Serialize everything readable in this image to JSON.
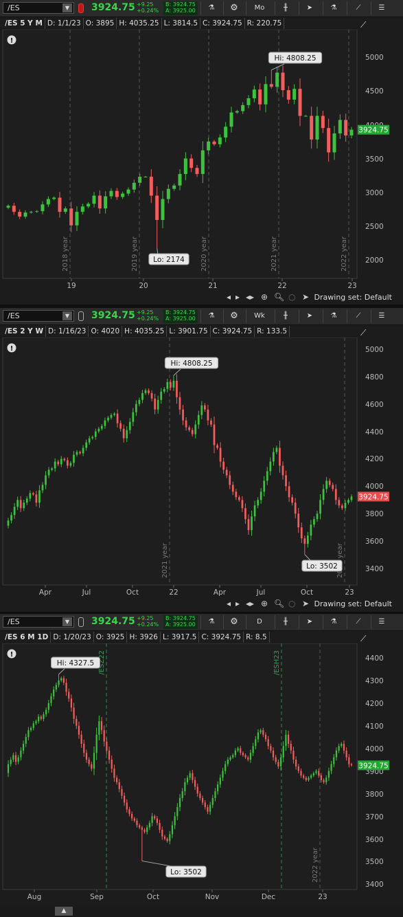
{
  "quote": {
    "price": "3924.75",
    "change": "+9.25",
    "change_pct": "+0.24%",
    "bid": "B: 3924.75",
    "ask": "A: 3925.00"
  },
  "footer": {
    "drawing_set": "Drawing set: Default"
  },
  "colors": {
    "up": "#3cc23c",
    "down": "#f25d5d",
    "price_label": "#1faa2f",
    "price_label_down": "#e84c4c"
  },
  "panels": [
    {
      "symbol": "/ES",
      "aggregation": "Mo",
      "link_color": "red",
      "info": {
        "title": "/ES 5 Y M",
        "date": "D: 1/1/23",
        "open": "O: 3895",
        "high": "H: 4035.25",
        "low": "L: 3814.5",
        "close": "C: 3924.75",
        "range": "R: 220.75"
      },
      "hi_label": "Hi: 4808.25",
      "lo_label": "Lo: 2174",
      "price_tag": "3924.75",
      "y_ticks": [
        "5000",
        "4500",
        "4000",
        "3500",
        "3000",
        "2500",
        "2000"
      ],
      "x_ticks": [
        "19",
        "20",
        "21",
        "22",
        "23"
      ],
      "period_labels": [
        "2018 year",
        "2019 year",
        "2020 year",
        "2021 year",
        "2022 year"
      ]
    },
    {
      "symbol": "/ES",
      "aggregation": "Wk",
      "link_color": "none",
      "info": {
        "title": "/ES 2 Y W",
        "date": "D: 1/16/23",
        "open": "O: 4020",
        "high": "H: 4035.25",
        "low": "L: 3901.75",
        "close": "C: 3924.75",
        "range": "R: 133.5"
      },
      "hi_label": "Hi: 4808.25",
      "lo_label": "Lo: 3502",
      "price_tag": "3924.75",
      "y_ticks": [
        "5000",
        "4800",
        "4600",
        "4400",
        "4200",
        "4000",
        "3800",
        "3600",
        "3400"
      ],
      "x_ticks": [
        "Apr",
        "Jul",
        "Oct",
        "22",
        "Apr",
        "Jul",
        "Oct",
        "23"
      ],
      "period_labels": [
        "2021 year",
        "2022 year"
      ]
    },
    {
      "symbol": "/ES",
      "aggregation": "D",
      "link_color": "none",
      "info": {
        "title": "/ES 6 M 1D",
        "date": "D: 1/20/23",
        "open": "O: 3925",
        "high": "H: 3926",
        "low": "L: 3917.5",
        "close": "C: 3924.75",
        "range": "R: 8.5"
      },
      "hi_label": "Hi: 4327.5",
      "lo_label": "Lo: 3502",
      "price_tag": "3924.75",
      "y_ticks": [
        "4400",
        "4300",
        "4200",
        "4100",
        "4000",
        "3900",
        "3800",
        "3700",
        "3600",
        "3500",
        "3400"
      ],
      "x_ticks": [
        "Aug",
        "Sep",
        "Oct",
        "Nov",
        "Dec",
        "23"
      ],
      "period_labels": [
        "/ESZ22",
        "/ESH23",
        "2022 year"
      ]
    }
  ],
  "chart_data": [
    {
      "type": "candlestick",
      "title": "/ES 5 Y M",
      "ylim": [
        1800,
        5200
      ],
      "series": [
        {
          "name": "/ES monthly",
          "close": [
            2800,
            2710,
            2640,
            2700,
            2710,
            2720,
            2820,
            2900,
            2920,
            2710,
            2760,
            2510,
            2710,
            2790,
            2830,
            2950,
            2760,
            2940,
            3020,
            2930,
            2980,
            3040,
            3140,
            3230,
            3230,
            2950,
            2590,
            2900,
            3050,
            3100,
            3270,
            3500,
            3360,
            3270,
            3620,
            3750,
            3710,
            3810,
            3970,
            4180,
            4200,
            4290,
            4390,
            4520,
            4300,
            4600,
            4560,
            4770,
            4510,
            4370,
            4530,
            4130,
            4130,
            3780,
            4130,
            3950,
            3590,
            3870,
            4070,
            3840,
            3925
          ]
        }
      ],
      "hi": 4808.25,
      "lo": 2174,
      "last": 3924.75
    },
    {
      "type": "candlestick",
      "title": "/ES 2 Y W",
      "ylim": [
        3250,
        5100
      ],
      "series": [
        {
          "name": "/ES weekly",
          "close": [
            3750,
            3790,
            3850,
            3900,
            3840,
            3880,
            3910,
            3950,
            3940,
            3880,
            3970,
            4010,
            4080,
            4120,
            4130,
            4180,
            4160,
            4200,
            4190,
            4150,
            4170,
            4230,
            4250,
            4240,
            4280,
            4320,
            4350,
            4360,
            4400,
            4420,
            4440,
            4480,
            4500,
            4520,
            4530,
            4460,
            4420,
            4350,
            4410,
            4470,
            4540,
            4600,
            4630,
            4680,
            4700,
            4680,
            4640,
            4560,
            4630,
            4690,
            4710,
            4760,
            4720,
            4770,
            4650,
            4560,
            4480,
            4430,
            4410,
            4380,
            4450,
            4520,
            4590,
            4560,
            4480,
            4450,
            4300,
            4280,
            4180,
            4120,
            4080,
            4010,
            3960,
            3920,
            3900,
            3840,
            3760,
            3680,
            3780,
            3860,
            3900,
            3960,
            4040,
            4110,
            4180,
            4250,
            4280,
            4150,
            4080,
            4000,
            3920,
            3880,
            3800,
            3700,
            3620,
            3580,
            3640,
            3720,
            3760,
            3800,
            3900,
            3980,
            4040,
            4010,
            3980,
            3900,
            3860,
            3840,
            3880,
            3900,
            3925
          ]
        }
      ],
      "hi": 4808.25,
      "lo": 3502,
      "last": 3924.75
    },
    {
      "type": "candlestick",
      "title": "/ES 6 M 1D",
      "ylim": [
        3380,
        4460
      ],
      "series": [
        {
          "name": "/ES daily",
          "close": [
            3930,
            3950,
            3970,
            3940,
            3960,
            3990,
            4020,
            4050,
            4080,
            4090,
            4110,
            4120,
            4140,
            4130,
            4150,
            4170,
            4200,
            4230,
            4260,
            4280,
            4300,
            4310,
            4290,
            4250,
            4220,
            4180,
            4130,
            4100,
            4060,
            4020,
            3980,
            3950,
            3930,
            3910,
            3980,
            4060,
            4120,
            4080,
            4030,
            3990,
            3950,
            3910,
            3870,
            3850,
            3820,
            3790,
            3760,
            3730,
            3710,
            3690,
            3680,
            3660,
            3650,
            3640,
            3630,
            3650,
            3670,
            3700,
            3690,
            3670,
            3640,
            3610,
            3600,
            3590,
            3620,
            3660,
            3700,
            3740,
            3780,
            3810,
            3850,
            3870,
            3890,
            3860,
            3830,
            3800,
            3780,
            3760,
            3740,
            3720,
            3750,
            3780,
            3810,
            3840,
            3870,
            3900,
            3930,
            3950,
            3960,
            3970,
            3990,
            4000,
            3980,
            3970,
            3960,
            3950,
            3980,
            4010,
            4040,
            4070,
            4080,
            4060,
            4040,
            4010,
            3990,
            3960,
            3940,
            3920,
            3960,
            4010,
            4060,
            4020,
            3990,
            3950,
            3920,
            3900,
            3880,
            3870,
            3860,
            3870,
            3880,
            3890,
            3900,
            3880,
            3860,
            3850,
            3870,
            3900,
            3930,
            3960,
            3990,
            4010,
            4020,
            3990,
            3960,
            3930,
            3925
          ]
        }
      ],
      "hi": 4327.5,
      "lo": 3502,
      "last": 3924.75
    }
  ]
}
